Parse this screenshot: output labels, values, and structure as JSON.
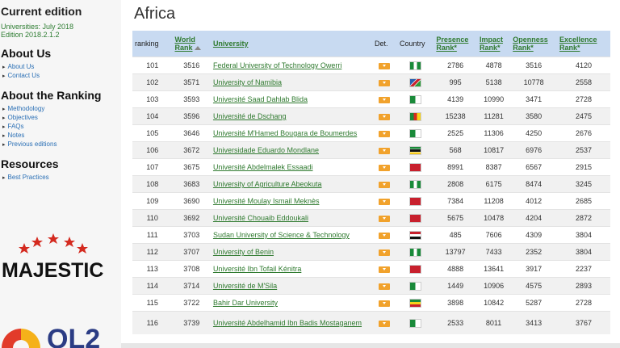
{
  "sidebar": {
    "current_edition_heading": "Current edition",
    "edition_lines": [
      "Universities: July 2018",
      "Edition 2018.2.1.2"
    ],
    "about_us_heading": "About Us",
    "about_us_items": [
      "About Us",
      "Contact Us"
    ],
    "about_ranking_heading": "About the Ranking",
    "about_ranking_items": [
      "Methodology",
      "Objectives",
      "FAQs",
      "Notes",
      "Previous editions"
    ],
    "resources_heading": "Resources",
    "resources_items": [
      "Best Practices"
    ],
    "logo_majestic_text": "MAJESTIC",
    "logo_ql2_text": "QL2"
  },
  "main": {
    "title": "Africa",
    "headers": {
      "ranking": "ranking",
      "world_rank_1": "World",
      "world_rank_2": "Rank",
      "university": "University",
      "det": "Det.",
      "country": "Country",
      "presence_1": "Presence",
      "presence_2": "Rank*",
      "impact_1": "Impact",
      "impact_2": "Rank*",
      "openness_1": "Openness",
      "openness_2": "Rank*",
      "excellence_1": "Excellence",
      "excellence_2": "Rank*"
    },
    "rows": [
      {
        "ranking": "101",
        "world": "3516",
        "name": "Federal University of Technology Owerri",
        "flag": "nigeria",
        "presence": "2786",
        "impact": "4878",
        "openness": "3516",
        "excellence": "4120"
      },
      {
        "ranking": "102",
        "world": "3571",
        "name": "University of Namibia",
        "flag": "namibia",
        "presence": "995",
        "impact": "5138",
        "openness": "10778",
        "excellence": "2558"
      },
      {
        "ranking": "103",
        "world": "3593",
        "name": "Université Saad Dahlab Blida",
        "flag": "algeria",
        "presence": "4139",
        "impact": "10990",
        "openness": "3471",
        "excellence": "2728"
      },
      {
        "ranking": "104",
        "world": "3596",
        "name": "Université de Dschang",
        "flag": "cameroon",
        "presence": "15238",
        "impact": "11281",
        "openness": "3580",
        "excellence": "2475"
      },
      {
        "ranking": "105",
        "world": "3646",
        "name": "Université M'Hamed Bougara de Boumerdes",
        "flag": "algeria",
        "presence": "2525",
        "impact": "11306",
        "openness": "4250",
        "excellence": "2676"
      },
      {
        "ranking": "106",
        "world": "3672",
        "name": "Universidade Eduardo Mondlane",
        "flag": "mozambique",
        "presence": "568",
        "impact": "10817",
        "openness": "6976",
        "excellence": "2537"
      },
      {
        "ranking": "107",
        "world": "3675",
        "name": "Université Abdelmalek Essaadi",
        "flag": "morocco",
        "presence": "8991",
        "impact": "8387",
        "openness": "6567",
        "excellence": "2915"
      },
      {
        "ranking": "108",
        "world": "3683",
        "name": "University of Agriculture Abeokuta",
        "flag": "nigeria",
        "presence": "2808",
        "impact": "6175",
        "openness": "8474",
        "excellence": "3245"
      },
      {
        "ranking": "109",
        "world": "3690",
        "name": "Université Moulay Ismail Meknès",
        "flag": "morocco",
        "presence": "7384",
        "impact": "11208",
        "openness": "4012",
        "excellence": "2685"
      },
      {
        "ranking": "110",
        "world": "3692",
        "name": "Université Chouaib Eddoukali",
        "flag": "morocco",
        "presence": "5675",
        "impact": "10478",
        "openness": "4204",
        "excellence": "2872"
      },
      {
        "ranking": "111",
        "world": "3703",
        "name": "Sudan University of Science & Technology",
        "flag": "sudan",
        "presence": "485",
        "impact": "7606",
        "openness": "4309",
        "excellence": "3804"
      },
      {
        "ranking": "112",
        "world": "3707",
        "name": "University of Benin",
        "flag": "nigeria",
        "presence": "13797",
        "impact": "7433",
        "openness": "2352",
        "excellence": "3804"
      },
      {
        "ranking": "113",
        "world": "3708",
        "name": "Université Ibn Tofail Kénitra",
        "flag": "morocco",
        "presence": "4888",
        "impact": "13641",
        "openness": "3917",
        "excellence": "2237"
      },
      {
        "ranking": "114",
        "world": "3714",
        "name": "Université de M'Sila",
        "flag": "algeria",
        "presence": "1449",
        "impact": "10906",
        "openness": "4575",
        "excellence": "2893"
      },
      {
        "ranking": "115",
        "world": "3722",
        "name": "Bahir Dar University",
        "flag": "ethiopia",
        "presence": "3898",
        "impact": "10842",
        "openness": "5287",
        "excellence": "2728"
      },
      {
        "ranking": "116",
        "world": "3739",
        "name": "Université Abdelhamid Ibn Badis Mostaganem",
        "flag": "algeria",
        "presence": "2533",
        "impact": "8011",
        "openness": "3413",
        "excellence": "3767"
      }
    ]
  },
  "colors": {
    "header_bg": "#c8daf1",
    "link_green": "#2f7a2f",
    "det_orange": "#f1a22c",
    "sidebar_bg": "#f6f6f6"
  }
}
